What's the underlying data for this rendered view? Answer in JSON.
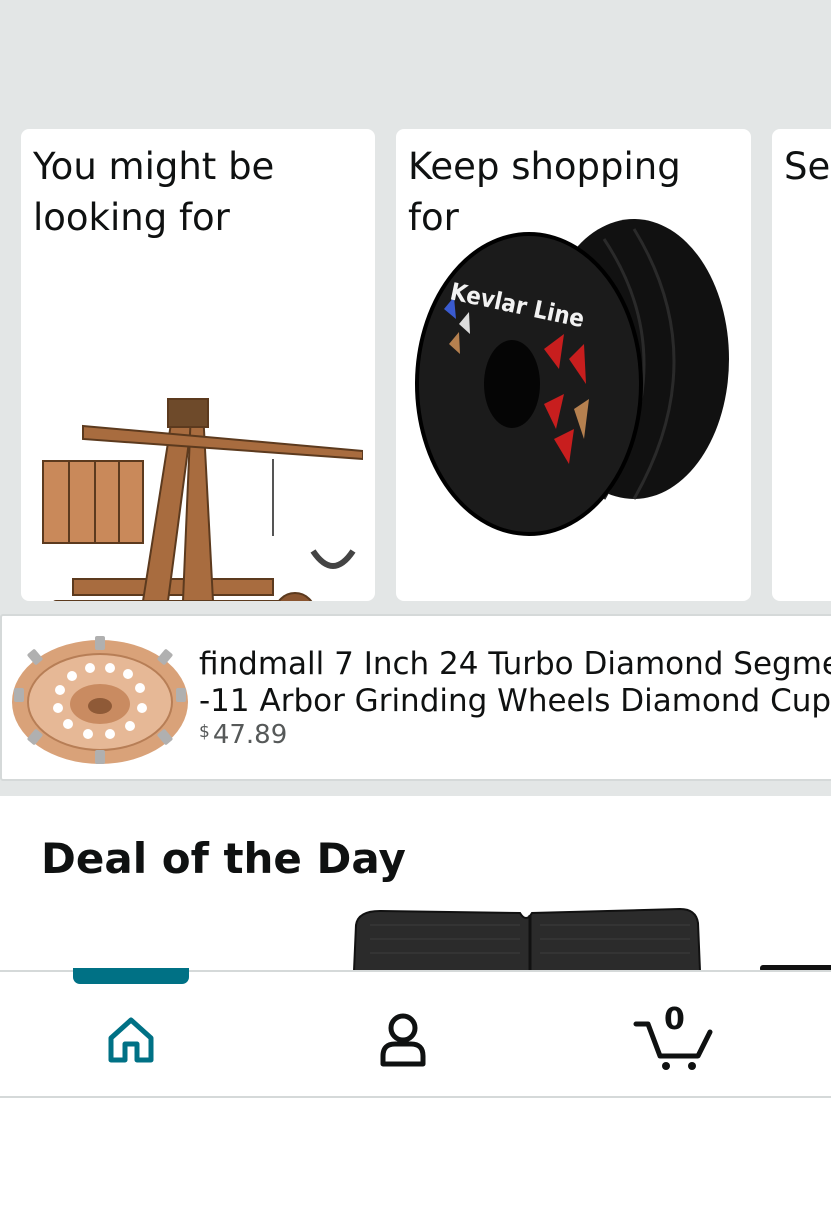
{
  "cards": [
    {
      "title": "You might be looking for",
      "image": "wooden-trebuchet-model"
    },
    {
      "title": "Keep shopping for",
      "image": "kevlar-line-spool",
      "image_text": "Kevlar Line"
    },
    {
      "title": "Sel"
    }
  ],
  "product": {
    "title_line1": "findmall 7 Inch 24 Turbo Diamond Segme",
    "title_line2": "-11 Arbor Grinding Wheels Diamond Cup",
    "currency": "$",
    "price": "47.89",
    "image": "diamond-cup-grinding-wheel"
  },
  "deal": {
    "title": "Deal of the Day",
    "image": "black-mesh-product"
  },
  "nav": {
    "items": [
      {
        "name": "home",
        "icon": "home-icon",
        "active": true
      },
      {
        "name": "account",
        "icon": "person-icon",
        "active": false
      },
      {
        "name": "cart",
        "icon": "cart-icon",
        "active": false
      }
    ],
    "cart_count": "0"
  },
  "colors": {
    "accent": "#007185",
    "background_band": "#e3e6e6",
    "text": "#0f1111",
    "price": "#565959"
  }
}
